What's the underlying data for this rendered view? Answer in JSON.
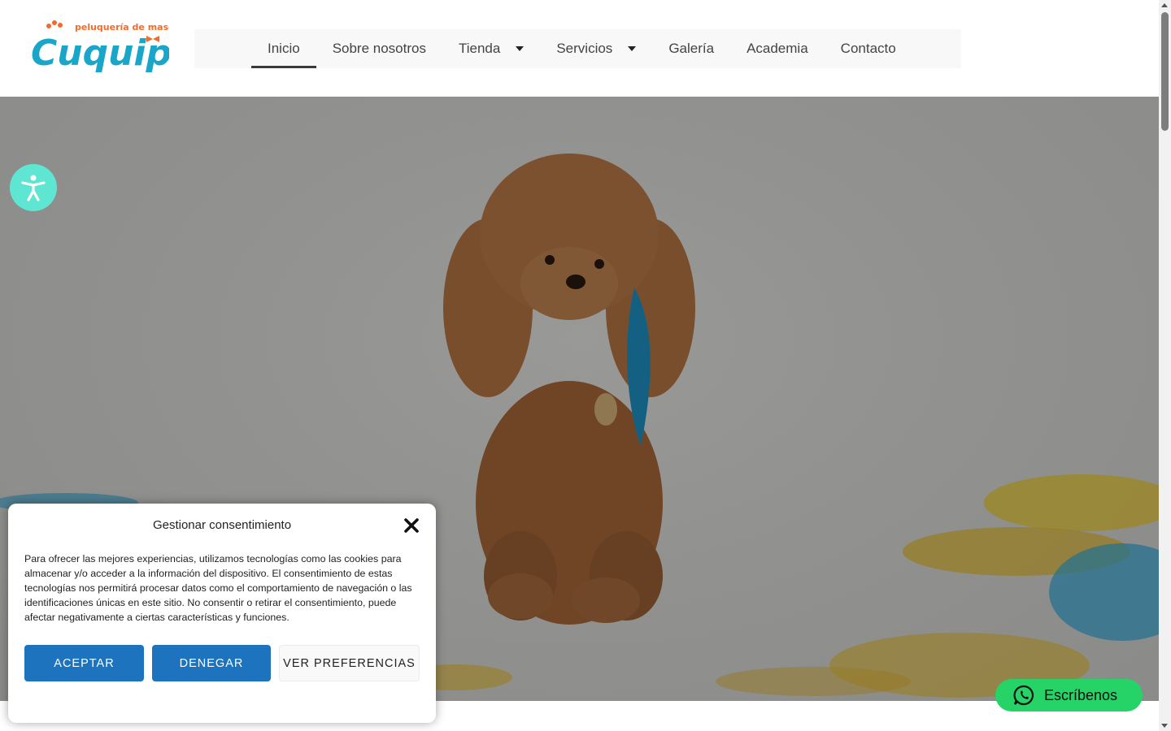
{
  "brand": {
    "logo_tagline": "peluquería de mascotas",
    "logo_text": "Cuquipet"
  },
  "nav": {
    "items": [
      {
        "label": "Inicio"
      },
      {
        "label": "Sobre nosotros"
      },
      {
        "label": "Tienda"
      },
      {
        "label": "Servicios"
      },
      {
        "label": "Galería"
      },
      {
        "label": "Academia"
      },
      {
        "label": "Contacto"
      }
    ]
  },
  "consent": {
    "title": "Gestionar consentimiento",
    "body": "Para ofrecer las mejores experiencias, utilizamos tecnologías como las cookies para almacenar y/o acceder a la información del dispositivo. El consentimiento de estas tecnologías nos permitirá procesar datos como el comportamiento de navegación o las identificaciones únicas en este sitio. No consentir o retirar el consentimiento, puede afectar negativamente a ciertas características y funciones.",
    "accept": "ACEPTAR",
    "deny": "DENEGAR",
    "preferences": "VER PREFERENCIAS"
  },
  "whatsapp": {
    "label": "Escríbenos"
  },
  "colors": {
    "primary_button": "#1e73be",
    "whatsapp": "#25d366",
    "accessibility": "#5ee6d2",
    "logo_teal": "#1aa6c8",
    "logo_orange": "#f26b2a"
  }
}
